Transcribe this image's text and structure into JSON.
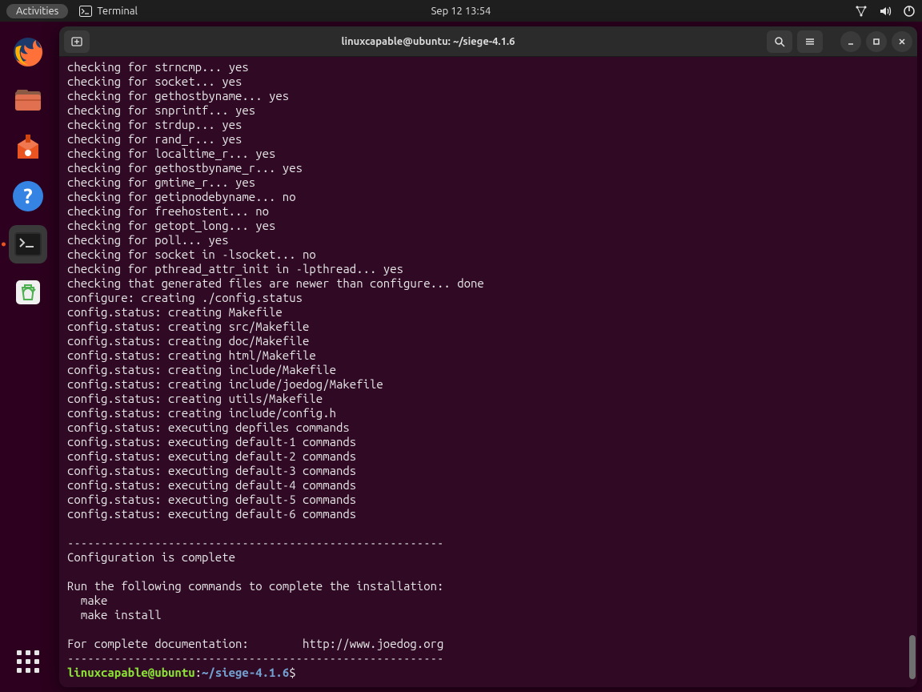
{
  "top_panel": {
    "activities": "Activities",
    "app_label": "Terminal",
    "clock": "Sep 12  13:54"
  },
  "dock": {
    "items": [
      {
        "name": "firefox-icon"
      },
      {
        "name": "files-icon"
      },
      {
        "name": "software-icon"
      },
      {
        "name": "help-icon"
      },
      {
        "name": "terminal-icon"
      },
      {
        "name": "trash-icon"
      }
    ]
  },
  "titlebar": {
    "title": "linuxcapable@ubuntu: ~/siege-4.1.6"
  },
  "terminal": {
    "lines": [
      "checking for strncmp... yes",
      "checking for socket... yes",
      "checking for gethostbyname... yes",
      "checking for snprintf... yes",
      "checking for strdup... yes",
      "checking for rand_r... yes",
      "checking for localtime_r... yes",
      "checking for gethostbyname_r... yes",
      "checking for gmtime_r... yes",
      "checking for getipnodebyname... no",
      "checking for freehostent... no",
      "checking for getopt_long... yes",
      "checking for poll... yes",
      "checking for socket in -lsocket... no",
      "checking for pthread_attr_init in -lpthread... yes",
      "checking that generated files are newer than configure... done",
      "configure: creating ./config.status",
      "config.status: creating Makefile",
      "config.status: creating src/Makefile",
      "config.status: creating doc/Makefile",
      "config.status: creating html/Makefile",
      "config.status: creating include/Makefile",
      "config.status: creating include/joedog/Makefile",
      "config.status: creating utils/Makefile",
      "config.status: creating include/config.h",
      "config.status: executing depfiles commands",
      "config.status: executing default-1 commands",
      "config.status: executing default-2 commands",
      "config.status: executing default-3 commands",
      "config.status: executing default-4 commands",
      "config.status: executing default-5 commands",
      "config.status: executing default-6 commands",
      "",
      "--------------------------------------------------------",
      "Configuration is complete",
      "",
      "Run the following commands to complete the installation:",
      "  make",
      "  make install",
      "",
      "For complete documentation:        http://www.joedog.org",
      "--------------------------------------------------------"
    ],
    "prompt": {
      "user": "linuxcapable@ubuntu",
      "sep1": ":",
      "path": "~/siege-4.1.6",
      "sigil": "$"
    }
  },
  "colors": {
    "panel_bg": "#1e1e1e",
    "term_bg": "#300a24",
    "term_fg": "#e6e6e6",
    "prompt_user": "#8ae234",
    "prompt_path": "#729fcf"
  }
}
